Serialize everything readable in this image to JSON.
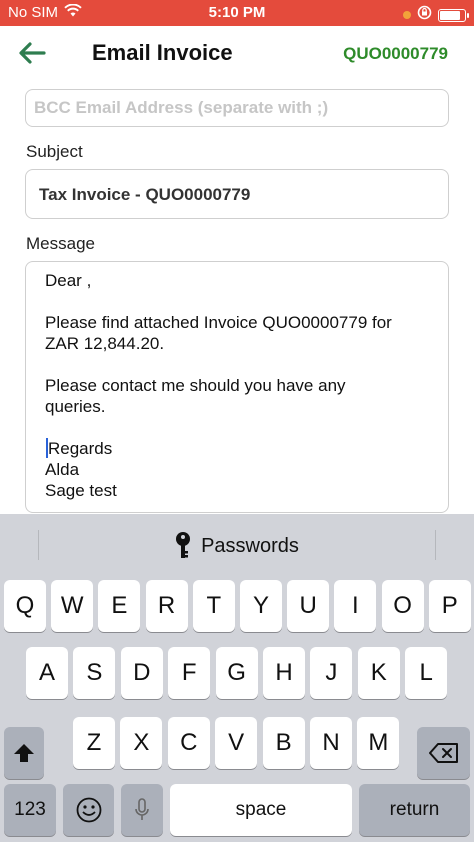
{
  "status_bar": {
    "carrier": "No SIM",
    "time": "5:10 PM",
    "battery_level": 0.85
  },
  "header": {
    "title": "Email Invoice",
    "quote_number": "QUO0000779"
  },
  "form": {
    "bcc_placeholder": "BCC Email Address (separate with ;)",
    "bcc_value": "",
    "subject_label": "Subject",
    "subject_value": "Tax Invoice - QUO0000779",
    "message_label": "Message",
    "message_lines": [
      "Dear ,",
      "",
      "Please find attached Invoice QUO0000779 for",
      "ZAR 12,844.20.",
      "",
      "Please contact me should you have any",
      "queries.",
      "",
      "Regards",
      "Alda",
      "Sage test"
    ]
  },
  "keyboard": {
    "suggestion": "Passwords",
    "row1": [
      "Q",
      "W",
      "E",
      "R",
      "T",
      "Y",
      "U",
      "I",
      "O",
      "P"
    ],
    "row2": [
      "A",
      "S",
      "D",
      "F",
      "G",
      "H",
      "J",
      "K",
      "L"
    ],
    "row3": [
      "Z",
      "X",
      "C",
      "V",
      "B",
      "N",
      "M"
    ],
    "numbers_label": "123",
    "space_label": "space",
    "return_label": "return"
  },
  "colors": {
    "status_bar": "#e44b3c",
    "accent_green": "#2e8b2a",
    "keyboard_bg": "#d1d3d9"
  }
}
